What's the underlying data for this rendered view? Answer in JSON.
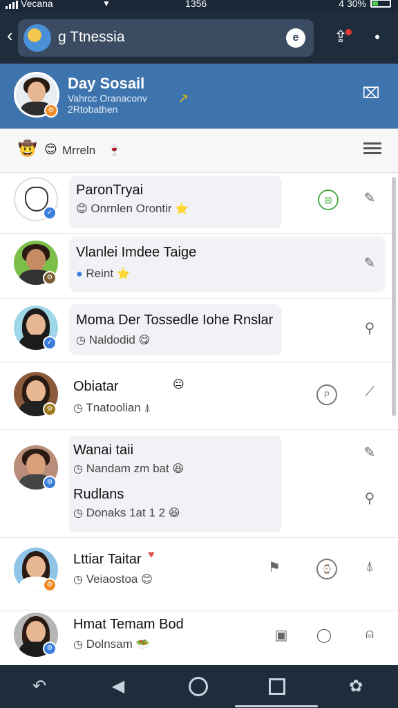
{
  "status_bar": {
    "carrier": "Vecana",
    "time": "1356",
    "battery": "4 30%"
  },
  "app_bar": {
    "search_text": "g Ttnessia",
    "share_badge": true
  },
  "profile": {
    "name": "Day Sosail",
    "subtitle_1": "Vahrcc Oranaconv",
    "subtitle_2": "2Rtobathen"
  },
  "filter": {
    "label": "Mrreln"
  },
  "conversations": [
    {
      "name": "ParonTryai",
      "preview": "Onrnlen Orontir",
      "badge": "check",
      "badge_color": "#3b7ddd",
      "actions": [
        "chat-circle-icon",
        "pencil-icon"
      ]
    },
    {
      "name": "Vlanlei Imdee Taige",
      "preview": "Reint",
      "badge": "gear",
      "badge_color": "#7a5c2e",
      "actions": [
        "pencil-icon"
      ]
    },
    {
      "name": "Moma Der Tossedle Iohe Rnslar",
      "preview": "Naldodid",
      "badge": "check",
      "badge_color": "#3b7ddd",
      "actions": [
        "search-icon"
      ]
    },
    {
      "name": "Obiatar",
      "preview": "Tnatoolian",
      "badge": "gear",
      "badge_color": "#a0781e",
      "actions": [
        "chat-circle-icon",
        "pin-icon"
      ]
    },
    {
      "name": "Wanai taii",
      "preview": "Nandam zm bat",
      "name_2": "Rudlans",
      "preview_2": "Donaks 1at 1 2",
      "badge": "gear",
      "badge_color": "#3b7ddd",
      "actions": [
        "pencil-icon",
        "search-icon"
      ]
    },
    {
      "name": "Lttiar Taitar",
      "preview": "Veiaostoa",
      "badge": "gear",
      "badge_color": "#f08a24",
      "actions": [
        "flag-icon",
        "chat-circle-icon",
        "bell-icon"
      ]
    },
    {
      "name": "Hmat Temam Bod",
      "preview": "Dolnsam",
      "badge": "gear",
      "badge_color": "#3b7ddd",
      "actions": [
        "calendar-icon",
        "refresh-icon",
        "user-icon"
      ]
    }
  ],
  "colors": {
    "header": "#3e74ae",
    "appbar": "#1e2c3c",
    "accent_green": "#4caf50"
  }
}
